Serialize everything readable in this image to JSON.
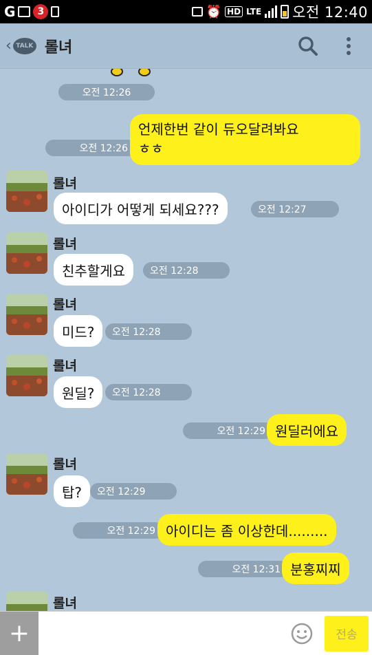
{
  "status_bar": {
    "notification_count": "3",
    "lte": "LTE",
    "hd": "HD",
    "time": "오전 12:40"
  },
  "header": {
    "talk_badge": "TALK",
    "title": "롤녀"
  },
  "messages": {
    "m0_time": "오전 12:26",
    "m1_text_line1": "언제한번 같이 듀오달려봐요",
    "m1_text_line2": "ㅎㅎ",
    "m1_time": "오전 12:26",
    "m2_sender": "롤녀",
    "m2_text": "아이디가 어떻게 되세요???",
    "m2_time": "오전 12:27",
    "m3_sender": "롤녀",
    "m3_text": "친추할게요",
    "m3_time": "오전 12:28",
    "m4_sender": "롤녀",
    "m4_text": "미드?",
    "m4_time": "오전 12:28",
    "m5_sender": "롤녀",
    "m5_text": "원딜?",
    "m5_time": "오전 12:28",
    "m6_text": "원딜러에요",
    "m6_time": "오전 12:29",
    "m7_sender": "롤녀",
    "m7_text": "탑?",
    "m7_time": "오전 12:29",
    "m8_text": "아이디는 좀 이상한데.........",
    "m8_time": "오전 12:29",
    "m9_text": "분홍찌찌",
    "m9_time": "오전 12:31",
    "m10_sender": "롤녀"
  },
  "input_bar": {
    "plus": "+",
    "placeholder": "",
    "send_label": "전송"
  },
  "colors": {
    "chat_bg": "#b2c7d9",
    "my_bubble": "#fef01b",
    "their_bubble": "#ffffff",
    "time_chip": "#8ea3b5"
  }
}
